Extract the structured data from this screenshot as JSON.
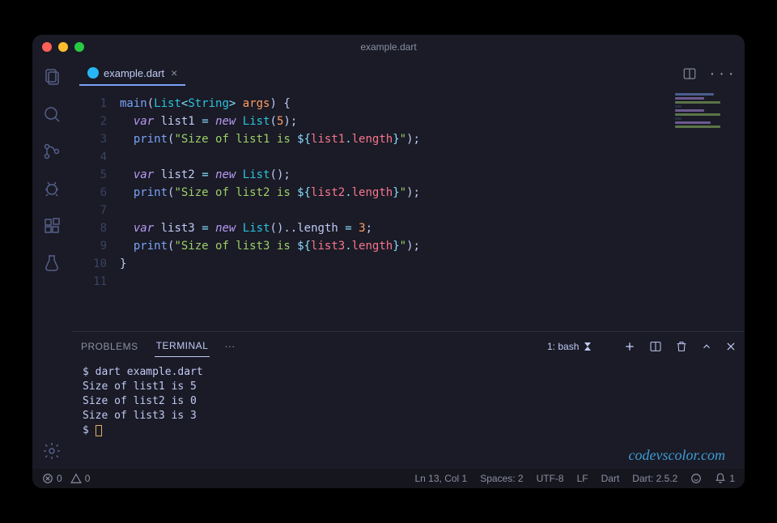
{
  "window": {
    "title": "example.dart"
  },
  "tab": {
    "filename": "example.dart"
  },
  "code": {
    "lines": [
      "1",
      "2",
      "3",
      "4",
      "5",
      "6",
      "7",
      "8",
      "9",
      "10",
      "11"
    ]
  },
  "panel": {
    "tabs": {
      "problems": "PROBLEMS",
      "terminal": "TERMINAL"
    },
    "shell_label": "1: bash"
  },
  "terminal": {
    "cmd": "dart example.dart",
    "out1": "Size of list1 is 5",
    "out2": "Size of list2 is 0",
    "out3": "Size of list3 is 3",
    "prompt": "$"
  },
  "status": {
    "errors": "0",
    "warnings": "0",
    "cursor": "Ln 13, Col 1",
    "spaces": "Spaces: 2",
    "encoding": "UTF-8",
    "eol": "LF",
    "lang": "Dart",
    "sdk": "Dart: 2.5.2",
    "bell": "1"
  },
  "watermark": "codevscolor.com",
  "src": {
    "main": "main",
    "List": "List",
    "String": "String",
    "args": "args",
    "var": "var",
    "new": "new",
    "print": "print",
    "list1": "list1",
    "list2": "list2",
    "list3": "list3",
    "length": "length",
    "five": "5",
    "three": "3",
    "s1a": "\"Size of list1 is ",
    "s2a": "\"Size of list2 is ",
    "s3a": "\"Size of list3 is ",
    "interp_open": "${",
    "interp_close": "}",
    "quote_close": "\""
  }
}
